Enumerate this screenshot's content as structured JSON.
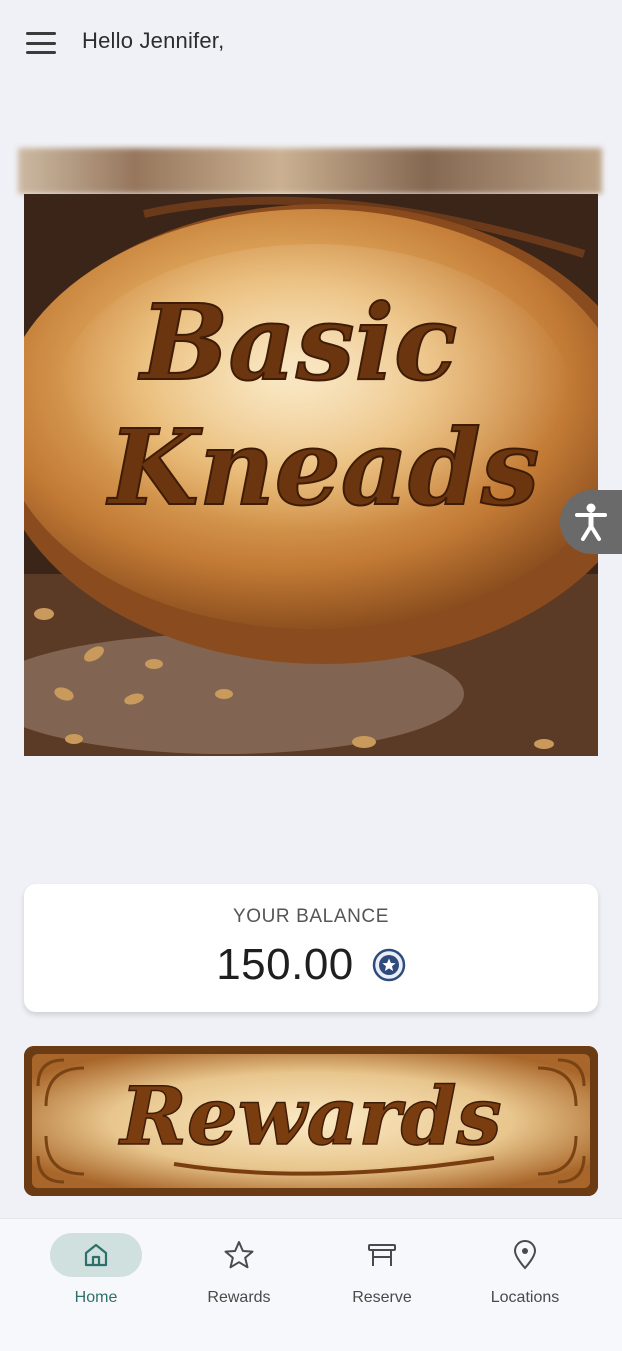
{
  "header": {
    "greeting": "Hello Jennifer,",
    "menu_icon": "hamburger-menu-icon"
  },
  "hero": {
    "brand_line1": "Basic",
    "brand_line2": "Kneads",
    "image": "bread-loaf-logo"
  },
  "balance": {
    "label": "YOUR BALANCE",
    "value": "150.00",
    "icon": "star-coin-icon"
  },
  "rewards_banner": {
    "text": "Rewards"
  },
  "nav": {
    "items": [
      {
        "label": "Home",
        "icon": "home-icon",
        "active": true
      },
      {
        "label": "Rewards",
        "icon": "star-icon",
        "active": false
      },
      {
        "label": "Reserve",
        "icon": "table-icon",
        "active": false
      },
      {
        "label": "Locations",
        "icon": "location-pin-icon",
        "active": false
      }
    ]
  },
  "colors": {
    "background": "#f0f1f6",
    "nav_active": "#2f6f6a",
    "nav_active_pill": "#cfe0de",
    "accessibility_button": "#6a6a6a"
  }
}
